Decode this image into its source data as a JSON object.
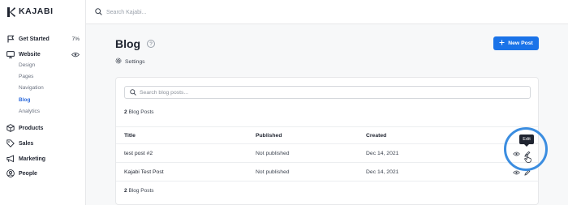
{
  "brand": {
    "name": "KAJABI"
  },
  "topbar": {
    "search_placeholder": "Search Kajabi..."
  },
  "sidebar": {
    "get_started": {
      "label": "Get Started",
      "progress": "7%"
    },
    "website": {
      "label": "Website",
      "children": [
        "Design",
        "Pages",
        "Navigation",
        "Blog",
        "Analytics"
      ],
      "active_child": "Blog"
    },
    "products": "Products",
    "sales": "Sales",
    "marketing": "Marketing",
    "people": "People"
  },
  "page": {
    "title": "Blog",
    "help": "?",
    "settings_label": "Settings",
    "new_post_label": "New Post"
  },
  "card": {
    "search_placeholder": "Search blog posts...",
    "count_number": "2",
    "count_label": "Blog Posts",
    "columns": [
      "Title",
      "Published",
      "Created"
    ],
    "rows": [
      {
        "title": "test post #2",
        "published": "Not published",
        "created": "Dec 14, 2021"
      },
      {
        "title": "Kajabi Test Post",
        "published": "Not published",
        "created": "Dec 14, 2021"
      }
    ]
  },
  "tooltip": "Edit",
  "colors": {
    "accent": "#1a73e8",
    "active_nav": "#2d6bdc",
    "highlight_ring": "#3b8de0"
  },
  "icons": [
    "kajabi-logo-icon",
    "search-icon",
    "flag-icon",
    "monitor-icon",
    "eye-icon",
    "box-icon",
    "tag-icon",
    "megaphone-icon",
    "person-icon",
    "help-icon",
    "gear-icon",
    "plus-icon",
    "pencil-icon",
    "hand-cursor-icon"
  ]
}
